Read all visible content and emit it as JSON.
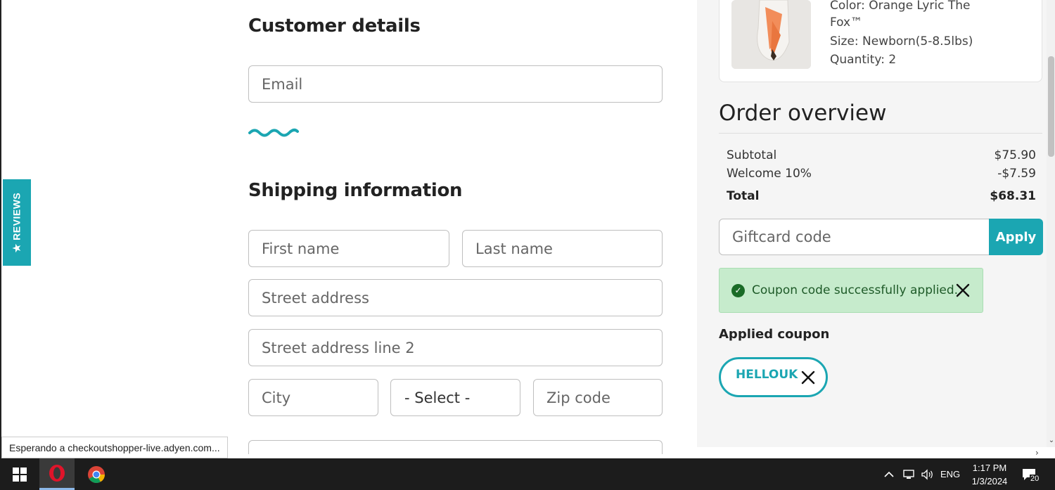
{
  "reviews_tab": {
    "label": "★ REVIEWS"
  },
  "customer_details": {
    "heading": "Customer details",
    "email_placeholder": "Email"
  },
  "shipping": {
    "heading": "Shipping information",
    "first_name_placeholder": "First name",
    "last_name_placeholder": "Last name",
    "street_placeholder": "Street address",
    "street2_placeholder": "Street address line 2",
    "city_placeholder": "City",
    "state_select": "- Select -",
    "zip_placeholder": "Zip code"
  },
  "product": {
    "color_line1": "Color: Orange Lyric The",
    "color_line2": "Fox™",
    "size": "Size: Newborn(5-8.5lbs)",
    "quantity": "Quantity: 2"
  },
  "order_overview": {
    "title": "Order overview",
    "rows": [
      {
        "label": "Subtotal",
        "value": "$75.90"
      },
      {
        "label": "Welcome 10%",
        "value": "-$7.59"
      }
    ],
    "total_label": "Total",
    "total_value": "$68.31"
  },
  "giftcard": {
    "placeholder": "Giftcard code",
    "apply_label": "Apply"
  },
  "alert": {
    "message": "Coupon code successfully applied."
  },
  "applied_coupon": {
    "label": "Applied coupon",
    "code": "HELLOUK"
  },
  "status_bar": {
    "text": "Esperando a checkoutshopper-live.adyen.com..."
  },
  "taskbar": {
    "language": "ENG",
    "time": "1:17 PM",
    "date": "1/3/2024",
    "notifications": "20"
  },
  "colors": {
    "accent": "#1ba6b2",
    "success_bg": "#c6ebcc",
    "success_text": "#1e5a28"
  }
}
